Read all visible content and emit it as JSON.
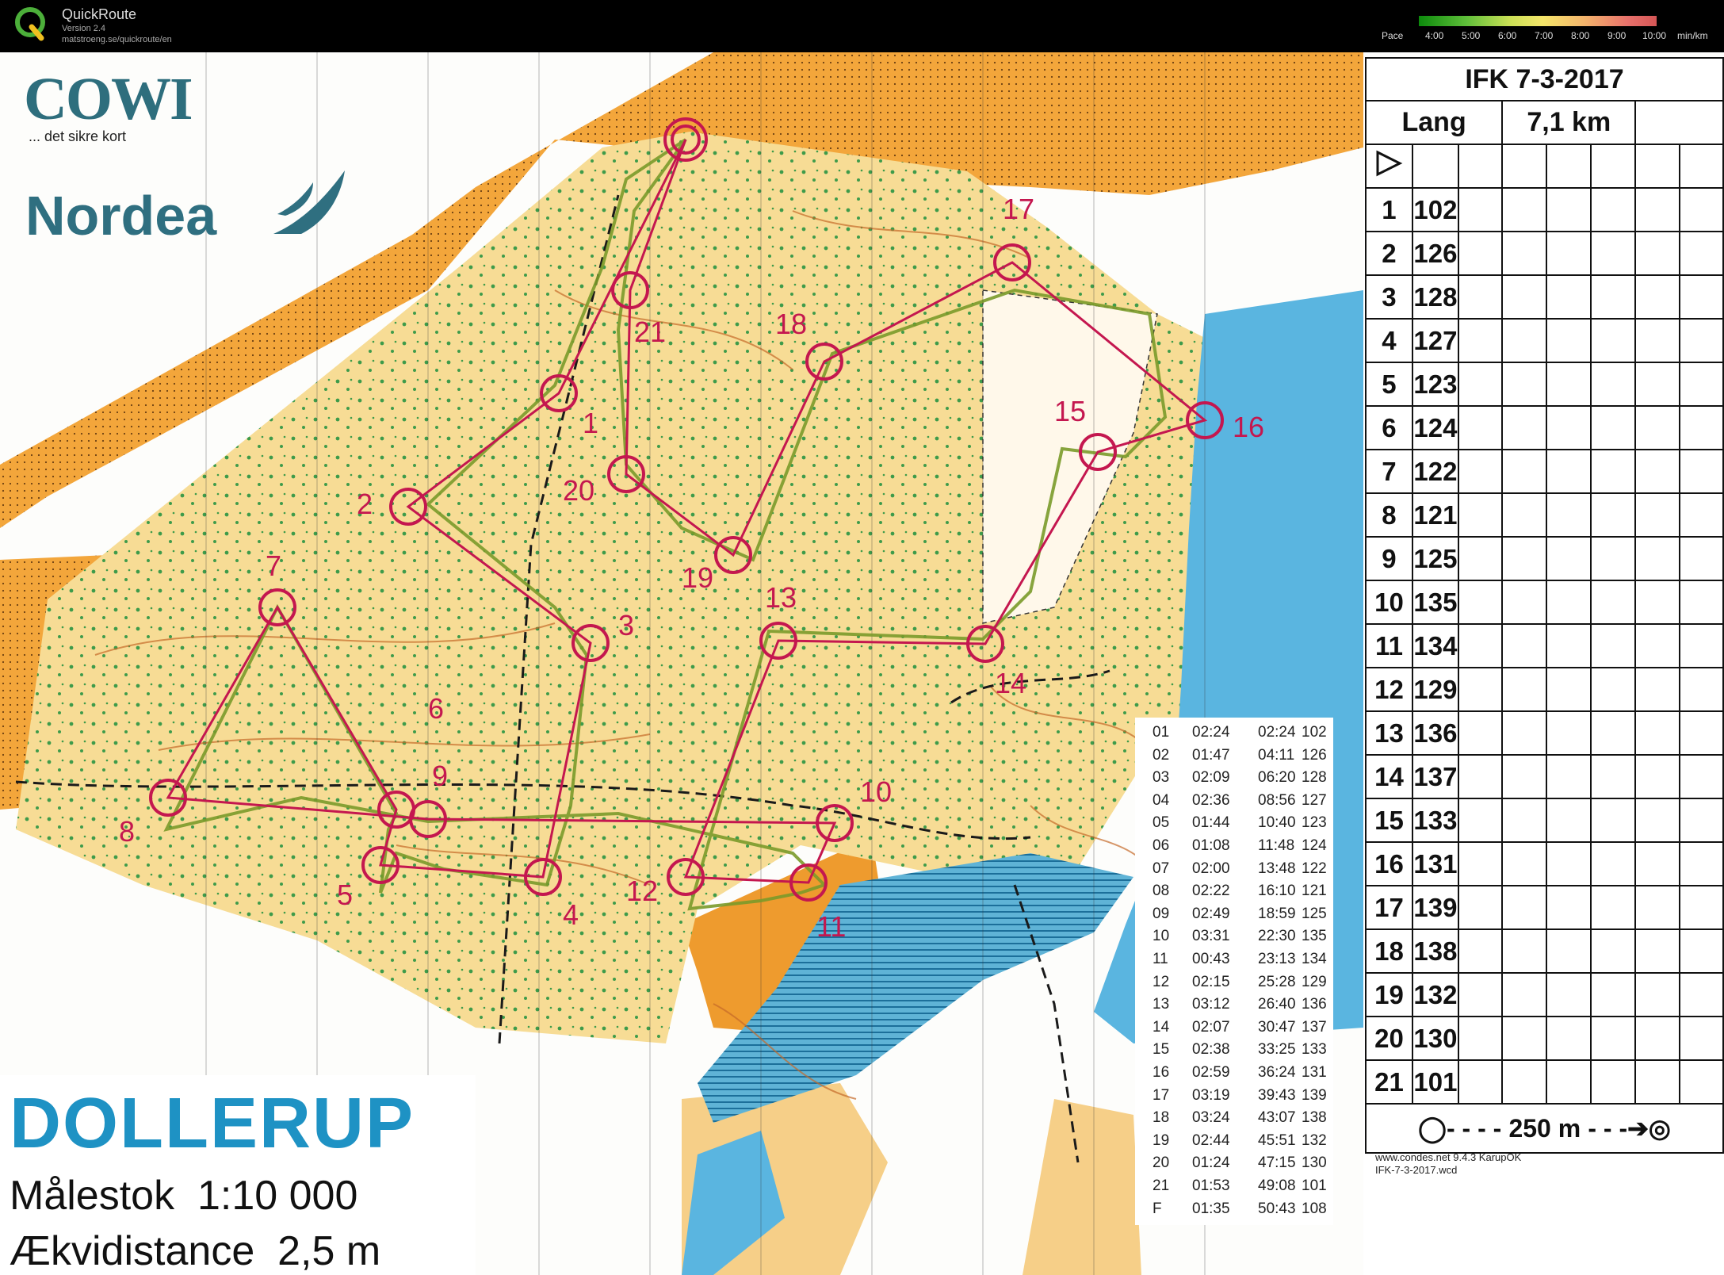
{
  "app": {
    "name": "QuickRoute",
    "version": "Version 2.4",
    "url": "matstroeng.se/quickroute/en"
  },
  "pace_legend": {
    "label": "Pace",
    "ticks": [
      "4:00",
      "5:00",
      "6:00",
      "7:00",
      "8:00",
      "9:00",
      "10:00"
    ],
    "unit": "min/km"
  },
  "map": {
    "sponsor1": "COWI",
    "sponsor1_tagline": "... det sikre kort",
    "sponsor2": "Nordea",
    "area_name": "DOLLERUP",
    "scale": "Målestok  1:10 000",
    "contour": "Ækvidistance  2,5 m",
    "controls": [
      "1",
      "2",
      "3",
      "4",
      "5",
      "6",
      "7",
      "8",
      "9",
      "10",
      "11",
      "12",
      "13",
      "14",
      "15",
      "16",
      "17",
      "18",
      "19",
      "20",
      "21"
    ]
  },
  "control_descriptions": {
    "event": "IFK 7-3-2017",
    "course": "Lang",
    "length": "7,1 km",
    "rows": [
      {
        "n": "1",
        "code": "102"
      },
      {
        "n": "2",
        "code": "126"
      },
      {
        "n": "3",
        "code": "128"
      },
      {
        "n": "4",
        "code": "127"
      },
      {
        "n": "5",
        "code": "123"
      },
      {
        "n": "6",
        "code": "124"
      },
      {
        "n": "7",
        "code": "122"
      },
      {
        "n": "8",
        "code": "121"
      },
      {
        "n": "9",
        "code": "125"
      },
      {
        "n": "10",
        "code": "135"
      },
      {
        "n": "11",
        "code": "134"
      },
      {
        "n": "12",
        "code": "129"
      },
      {
        "n": "13",
        "code": "136"
      },
      {
        "n": "14",
        "code": "137"
      },
      {
        "n": "15",
        "code": "133"
      },
      {
        "n": "16",
        "code": "131"
      },
      {
        "n": "17",
        "code": "139"
      },
      {
        "n": "18",
        "code": "138"
      },
      {
        "n": "19",
        "code": "132"
      },
      {
        "n": "20",
        "code": "130"
      },
      {
        "n": "21",
        "code": "101"
      }
    ],
    "finish": "250 m",
    "footer1": "www.condes.net 9.4.3 KarupOK",
    "footer2": "IFK-7-3-2017.wcd"
  },
  "splits": [
    {
      "leg": "01",
      "split": "02:24",
      "total": "02:24",
      "code": "102"
    },
    {
      "leg": "02",
      "split": "01:47",
      "total": "04:11",
      "code": "126"
    },
    {
      "leg": "03",
      "split": "02:09",
      "total": "06:20",
      "code": "128"
    },
    {
      "leg": "04",
      "split": "02:36",
      "total": "08:56",
      "code": "127"
    },
    {
      "leg": "05",
      "split": "01:44",
      "total": "10:40",
      "code": "123"
    },
    {
      "leg": "06",
      "split": "01:08",
      "total": "11:48",
      "code": "124"
    },
    {
      "leg": "07",
      "split": "02:00",
      "total": "13:48",
      "code": "122"
    },
    {
      "leg": "08",
      "split": "02:22",
      "total": "16:10",
      "code": "121"
    },
    {
      "leg": "09",
      "split": "02:49",
      "total": "18:59",
      "code": "125"
    },
    {
      "leg": "10",
      "split": "03:31",
      "total": "22:30",
      "code": "135"
    },
    {
      "leg": "11",
      "split": "00:43",
      "total": "23:13",
      "code": "134"
    },
    {
      "leg": "12",
      "split": "02:15",
      "total": "25:28",
      "code": "129"
    },
    {
      "leg": "13",
      "split": "03:12",
      "total": "26:40",
      "code": "136"
    },
    {
      "leg": "14",
      "split": "02:07",
      "total": "30:47",
      "code": "137"
    },
    {
      "leg": "15",
      "split": "02:38",
      "total": "33:25",
      "code": "133"
    },
    {
      "leg": "16",
      "split": "02:59",
      "total": "36:24",
      "code": "131"
    },
    {
      "leg": "17",
      "split": "03:19",
      "total": "39:43",
      "code": "139"
    },
    {
      "leg": "18",
      "split": "03:24",
      "total": "43:07",
      "code": "138"
    },
    {
      "leg": "19",
      "split": "02:44",
      "total": "45:51",
      "code": "132"
    },
    {
      "leg": "20",
      "split": "01:24",
      "total": "47:15",
      "code": "130"
    },
    {
      "leg": "21",
      "split": "01:53",
      "total": "49:08",
      "code": "101"
    },
    {
      "leg": "F",
      "split": "01:35",
      "total": "50:43",
      "code": "108"
    }
  ]
}
